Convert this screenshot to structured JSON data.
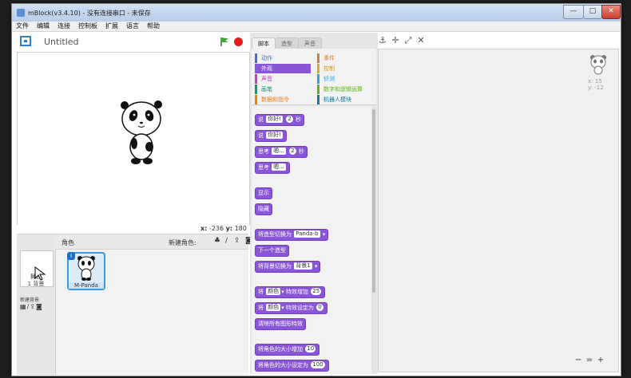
{
  "window": {
    "title": "mBlock(v3.4.10) - 没有连接串口 - 未保存",
    "minimize": "—",
    "maximize": "□",
    "close": "✕"
  },
  "menu": [
    "文件",
    "编辑",
    "连接",
    "控制板",
    "扩展",
    "语言",
    "帮助"
  ],
  "stage": {
    "project_title": "Untitled",
    "x_label": "x:",
    "x_value": "-236",
    "y_label": "y:",
    "y_value": "180"
  },
  "sprites": {
    "title": "角色",
    "new_sprite_label": "新建角色:",
    "stage_label": "舞台",
    "stage_backdrops": "1 背景",
    "new_backdrop_label": "新建背景",
    "sprite_name": "M-Panda",
    "sprite_badge": "i"
  },
  "palette": {
    "tabs": [
      "脚本",
      "造型",
      "声音"
    ],
    "categories_left": [
      "动作",
      "外观",
      "声音",
      "画笔",
      "数据和指令"
    ],
    "categories_right": [
      "事件",
      "控制",
      "侦测",
      "数字和逻辑运算",
      "机器人模块"
    ],
    "selected_category": "外观"
  },
  "blocks": {
    "say_timed": {
      "pre": "说",
      "text": "你好!",
      "secs": "2",
      "post": "秒"
    },
    "say": {
      "pre": "说",
      "text": "你好!"
    },
    "think_timed": {
      "pre": "思考",
      "text": "嗯...",
      "secs": "2",
      "post": "秒"
    },
    "think": {
      "pre": "思考",
      "text": "嗯..."
    },
    "show": "显示",
    "hide": "隐藏",
    "switch_costume": {
      "pre": "将造型切换为",
      "value": "Panda-b"
    },
    "next_costume": "下一个造型",
    "switch_backdrop": {
      "pre": "将背景切换为",
      "value": "背景1"
    },
    "change_effect": {
      "pre": "将",
      "effect": "颜色",
      "mid": "特效增加",
      "value": "25"
    },
    "set_effect": {
      "pre": "将",
      "effect": "颜色",
      "mid": "特效设定为",
      "value": "0"
    },
    "clear_effects": "清除所有图形特效",
    "change_size": {
      "pre": "将角色的大小增加",
      "value": "10"
    },
    "set_size": {
      "pre": "将角色的大小设定为",
      "value": "100"
    }
  },
  "script_area": {
    "x_readout": "x: 15",
    "y_readout": "y: -12",
    "zoom_out": "−",
    "zoom_reset": "=",
    "zoom_in": "+"
  },
  "colors": {
    "looks": "#8a55d7",
    "motion": "#4a6cd4",
    "sound": "#bb42c3",
    "pen": "#0e9a6c",
    "data": "#ee7d16",
    "events": "#c88330",
    "control": "#e1a91a",
    "sensing": "#2ca5e2",
    "operators": "#5cb712",
    "robots": "#0f7b9b"
  }
}
